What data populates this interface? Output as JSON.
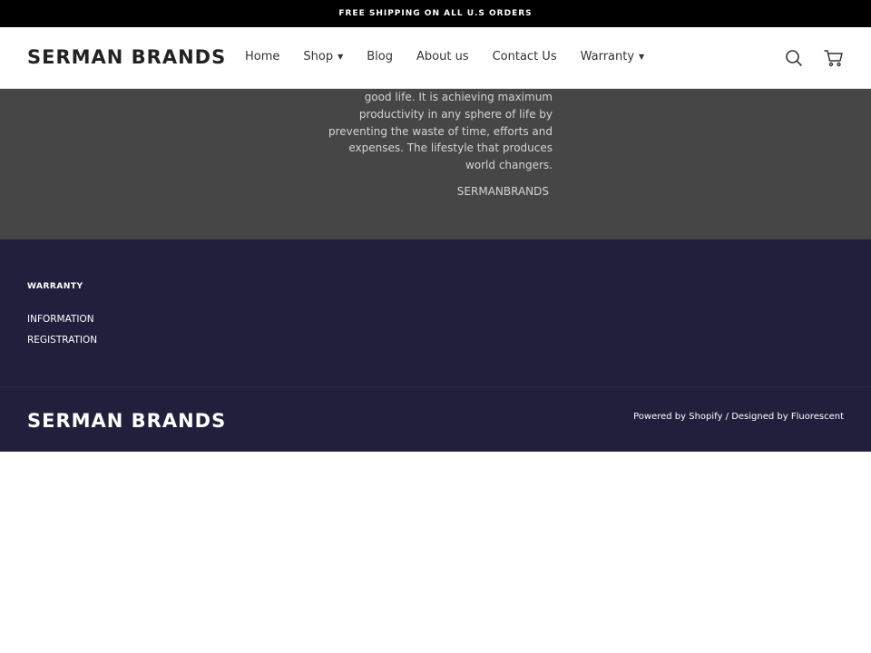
{
  "announcement": {
    "text": "FREE SHIPPING ON ALL U.S ORDERS"
  },
  "header": {
    "logo": "SERMAN BRANDS",
    "nav": [
      {
        "label": "Home"
      },
      {
        "label": "Shop",
        "dropdown": true
      },
      {
        "label": "Blog"
      },
      {
        "label": "About us"
      },
      {
        "label": "Contact Us"
      },
      {
        "label": "Warranty",
        "dropdown": true
      }
    ],
    "icons": [
      "search-icon",
      "cart-icon"
    ]
  },
  "quote": {
    "text": "good life. It is achieving maximum productivity in any sphere of life by preventing the waste of time, efforts and expenses. The lifestyle that produces world changers.",
    "author": "SERMANBRANDS"
  },
  "footer": {
    "heading": "WARRANTY",
    "links": [
      "INFORMATION",
      "REGISTRATION"
    ],
    "logo": "SERMAN BRANDS",
    "credits": {
      "powered": "Powered by Shopify",
      "separator": " / ",
      "designed": "Designed by Fluorescent"
    }
  },
  "colors": {
    "announcement_bg": "#000000",
    "quote_bg": "#464646",
    "footer_bg": "#20203d"
  }
}
